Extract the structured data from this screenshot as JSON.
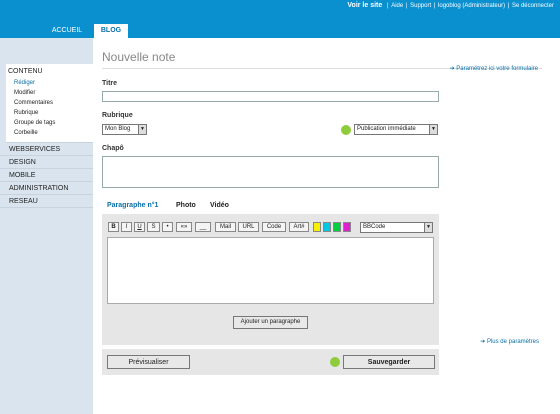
{
  "header": {
    "site_link": "Voir le site",
    "links": [
      "Aide",
      "Support",
      "logoblog (Administrateur)",
      "Se déconnecter"
    ],
    "tabs": [
      {
        "label": "ACCUEIL"
      },
      {
        "label": "BLOG"
      }
    ]
  },
  "sidebar": {
    "contenu": {
      "label": "CONTENU",
      "items": [
        "Rédiger",
        "Modifier",
        "Commentaires",
        "Rubrique",
        "Groupe de tags",
        "Corbeille"
      ]
    },
    "items": [
      "WEBSERVICES",
      "DESIGN",
      "MOBILE",
      "ADMINISTRATION",
      "RESEAU"
    ]
  },
  "main": {
    "title": "Nouvelle note",
    "param_link": "Paramétrez ici votre formulaire",
    "titre_label": "Titre",
    "titre_value": "",
    "rubrique_label": "Rubrique",
    "rubrique_value": "Mon Blog",
    "publication_value": "Publication immédiate",
    "chapo_label": "Chapô",
    "paragraph_tabs": [
      "Paragraphe n°1",
      "Photo",
      "Vidéo"
    ],
    "toolbar": {
      "bold": "B",
      "italic": "I",
      "underline": "U",
      "strike": "S",
      "bullet": "•",
      "quote": "«»",
      "hr": "__",
      "mail": "Mail",
      "url": "URL",
      "code": "Code",
      "art": "Art#",
      "dash": "-",
      "format": "BBCode"
    },
    "swatch_colors": [
      "#f5f000",
      "#00c8e0",
      "#00d040",
      "#e020d0"
    ],
    "add_paragraph": "Ajouter un paragraphe",
    "more_params": "Plus de paramètres",
    "preview": "Prévisualiser",
    "save": "Sauvegarder"
  },
  "colors": {
    "header_blue": "#0a8fcf",
    "sidebar_bg": "#d9e4ee",
    "status_green": "#8fcc3c"
  }
}
